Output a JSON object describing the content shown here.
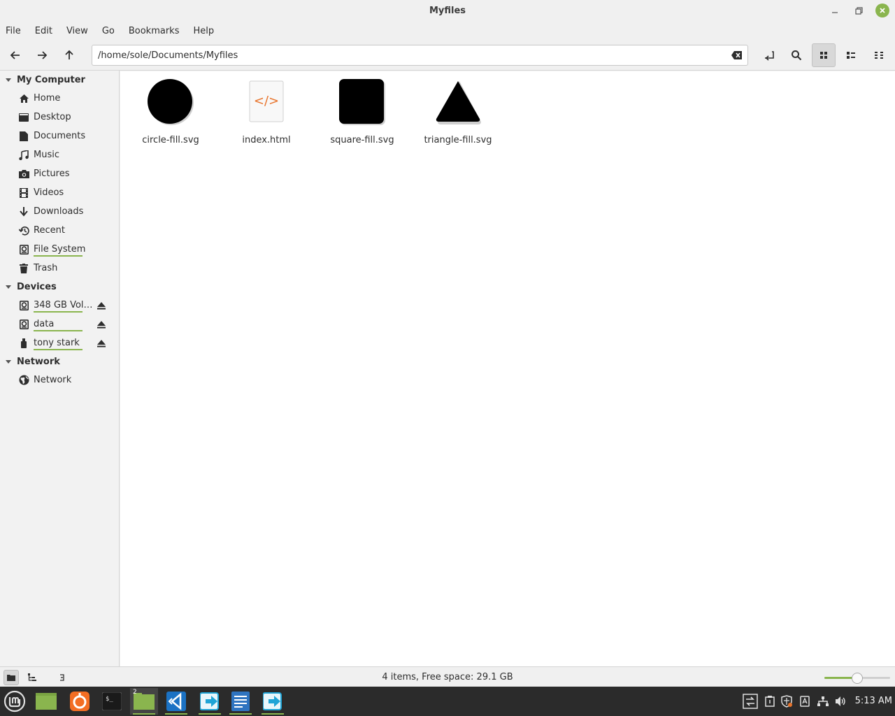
{
  "window": {
    "title": "Myfiles"
  },
  "menubar": {
    "items": [
      "File",
      "Edit",
      "View",
      "Go",
      "Bookmarks",
      "Help"
    ]
  },
  "toolbar": {
    "location": "/home/sole/Documents/Myfiles"
  },
  "sidebar": {
    "sections": [
      {
        "label": "My Computer"
      },
      {
        "label": "Devices"
      },
      {
        "label": "Network"
      }
    ],
    "my_computer": [
      {
        "label": "Home",
        "icon": "home-icon"
      },
      {
        "label": "Desktop",
        "icon": "desktop-icon"
      },
      {
        "label": "Documents",
        "icon": "document-icon"
      },
      {
        "label": "Music",
        "icon": "music-icon"
      },
      {
        "label": "Pictures",
        "icon": "camera-icon"
      },
      {
        "label": "Videos",
        "icon": "film-icon"
      },
      {
        "label": "Downloads",
        "icon": "download-icon"
      },
      {
        "label": "Recent",
        "icon": "history-icon"
      },
      {
        "label": "File System",
        "icon": "drive-icon"
      },
      {
        "label": "Trash",
        "icon": "trash-icon"
      }
    ],
    "devices": [
      {
        "label": "348 GB Vol…",
        "icon": "drive-icon"
      },
      {
        "label": "data",
        "icon": "drive-icon"
      },
      {
        "label": "tony stark",
        "icon": "usb-icon"
      }
    ],
    "network": [
      {
        "label": "Network",
        "icon": "globe-icon"
      }
    ]
  },
  "files": [
    {
      "name": "circle-fill.svg",
      "icon": "circle-thumbnail"
    },
    {
      "name": "index.html",
      "icon": "html-file-icon"
    },
    {
      "name": "square-fill.svg",
      "icon": "square-thumbnail"
    },
    {
      "name": "triangle-fill.svg",
      "icon": "triangle-thumbnail"
    }
  ],
  "html_glyph": "</>",
  "statusbar": {
    "text": "4 items, Free space: 29.1 GB",
    "zoom_level": 0.5
  },
  "taskbar": {
    "clock": "5:13 AM",
    "workspace_badge": "2"
  },
  "colors": {
    "accent": "#8ab54e",
    "html_orange": "#e8742c"
  }
}
